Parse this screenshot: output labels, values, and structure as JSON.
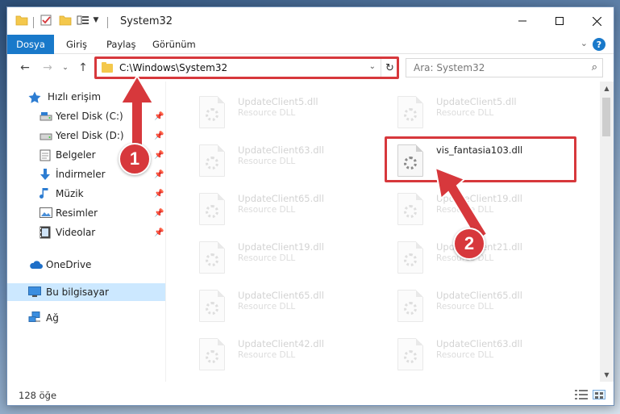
{
  "window": {
    "title": "System32"
  },
  "ribbon": {
    "tabs": [
      "Dosya",
      "Giriş",
      "Paylaş",
      "Görünüm"
    ]
  },
  "address": {
    "path": "C:\\Windows\\System32"
  },
  "search": {
    "placeholder": "Ara: System32"
  },
  "nav": {
    "quick_access": "Hızlı erişim",
    "items": [
      {
        "label": "Yerel Disk (C:)",
        "icon": "drive-icon"
      },
      {
        "label": "Yerel Disk (D:)",
        "icon": "drive-icon"
      },
      {
        "label": "Belgeler",
        "icon": "documents-icon"
      },
      {
        "label": "İndirmeler",
        "icon": "downloads-icon"
      },
      {
        "label": "Müzik",
        "icon": "music-icon"
      },
      {
        "label": "Resimler",
        "icon": "pictures-icon"
      },
      {
        "label": "Videolar",
        "icon": "videos-icon"
      }
    ],
    "onedrive": "OneDrive",
    "this_pc": "Bu bilgisayar",
    "network": "Ağ"
  },
  "files": {
    "left": [
      {
        "name": "UpdateClient5.dll",
        "type": "Resource DLL"
      },
      {
        "name": "UpdateClient63.dll",
        "type": "Resource DLL"
      },
      {
        "name": "UpdateClient65.dll",
        "type": "Resource DLL"
      },
      {
        "name": "UpdateClient19.dll",
        "type": "Resource DLL"
      },
      {
        "name": "UpdateClient65.dll",
        "type": "Resource DLL"
      },
      {
        "name": "UpdateClient42.dll",
        "type": "Resource DLL"
      }
    ],
    "right": [
      {
        "name": "UpdateClient5.dll",
        "type": "Resource DLL"
      },
      {
        "name": "vis_fantasia103.dll",
        "type": ""
      },
      {
        "name": "UpdateClient19.dll",
        "type": "Resource DLL"
      },
      {
        "name": "UpdateClient21.dll",
        "type": "Resource DLL"
      },
      {
        "name": "UpdateClient65.dll",
        "type": "Resource DLL"
      },
      {
        "name": "UpdateClient63.dll",
        "type": "Resource DLL"
      }
    ]
  },
  "status": {
    "count": "128 öğe"
  },
  "callouts": [
    "1",
    "2"
  ],
  "colors": {
    "accent": "#1979ca",
    "highlight": "#d7383c"
  }
}
